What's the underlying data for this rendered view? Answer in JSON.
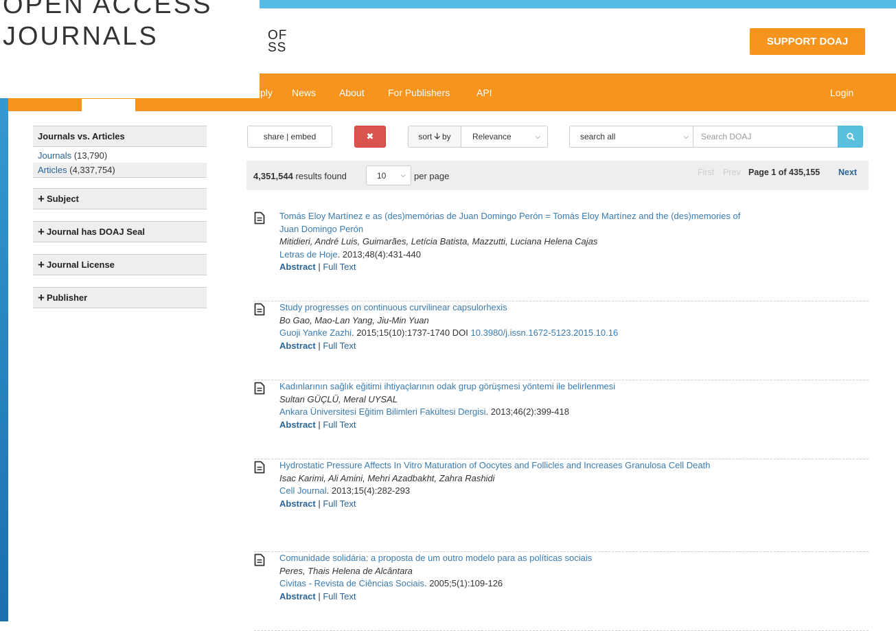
{
  "logo": {
    "line1": "OPEN ACCESS",
    "line2": "JOURNALS",
    "part1": "OF",
    "part2": "SS"
  },
  "header": {
    "support_label": "SUPPORT DOAJ"
  },
  "nav": {
    "items": [
      "ply",
      "News",
      "About",
      "For Publishers",
      "API"
    ],
    "login": "Login"
  },
  "sidebar": {
    "jva_title": "Journals vs. Articles",
    "journals_label": "Journals",
    "journals_count": "(13,790)",
    "articles_label": "Articles",
    "articles_count": "(4,337,754)",
    "facets": [
      "Subject",
      "Journal has DOAJ Seal",
      "Journal License",
      "Publisher"
    ]
  },
  "controls": {
    "share_label": "share | embed",
    "clear_icon": "✖",
    "sort_label": "sort",
    "sort_by": "by",
    "sort_value": "Relevance",
    "search_field": "search all",
    "search_placeholder": "Search DOAJ"
  },
  "results": {
    "count": "4,351,544",
    "found_text": "results found",
    "page_size": "10",
    "per_page": "per page",
    "first": "First",
    "prev": "Prev",
    "page_info": "Page 1 of 435,155",
    "next": "Next"
  },
  "items": [
    {
      "title": "Tomás Eloy Martínez e as (des)memórias de Juan Domingo Perón = Tomás Eloy Martínez and the (des)memories of Juan Domingo Perón",
      "authors": "Mitidieri, André Luis, Guimarães, Letícia Batista, Mazzutti, Luciana Helena Cajas",
      "journal": "Letras de Hoje",
      "citation": ". 2013;48(4):431-440",
      "doi_label": "",
      "doi": "",
      "abstract": "Abstract",
      "fulltext": "Full Text"
    },
    {
      "title": "Study progresses on continuous curvilinear capsulorhexis",
      "authors": "Bo Gao, Mao-Lan Yang, Jiu-Min Yuan",
      "journal": "Guoji Yanke Zazhi",
      "citation": ". 2015;15(10):1737-1740",
      "doi_label": "DOI",
      "doi": "10.3980/j.issn.1672-5123.2015.10.16",
      "abstract": "Abstract",
      "fulltext": "Full Text"
    },
    {
      "title": "Kadınlarının sağlık eğitimi ihtiyaçlarının odak grup görüşmesi yöntemi ile belirlenmesi",
      "authors": "Sultan GÜÇLÜ, Meral UYSAL",
      "journal": "Ankara Üniversitesi Eğitim Bilimleri Fakültesi Dergisi",
      "citation": ". 2013;46(2):399-418",
      "doi_label": "",
      "doi": "",
      "abstract": "Abstract",
      "fulltext": "Full Text"
    },
    {
      "title": "Hydrostatic Pressure Affects In Vitro Maturation of Oocytes and Follicles and Increases Granulosa Cell Death",
      "authors": "Isac Karimi, Ali Amini, Mehri Azadbakht, Zahra Rashidi",
      "journal": "Cell Journal",
      "citation": ". 2013;15(4):282-293",
      "doi_label": "",
      "doi": "",
      "abstract": "Abstract",
      "fulltext": "Full Text"
    },
    {
      "title": "Comunidade solidária: a proposta de um outro modelo para as políticas sociais",
      "authors": "Peres, Thais Helena de Alcântara",
      "journal": "Civitas - Revista de Ciências Sociais",
      "citation": ". 2005;5(1):109-126",
      "doi_label": "",
      "doi": "",
      "abstract": "Abstract",
      "fulltext": "Full Text"
    }
  ]
}
